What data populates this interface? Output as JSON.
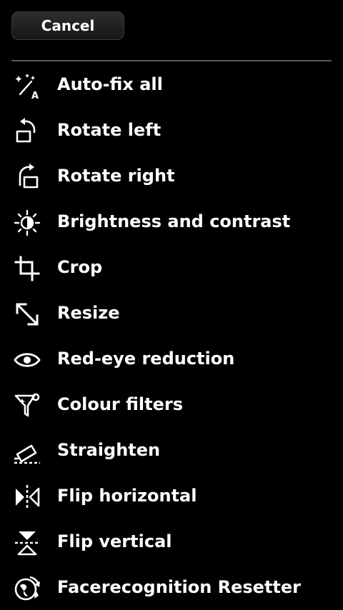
{
  "header": {
    "cancel_label": "Cancel"
  },
  "menu": {
    "items": [
      {
        "label": "Auto-fix all",
        "icon": "magic-wand-icon"
      },
      {
        "label": "Rotate left",
        "icon": "rotate-left-icon"
      },
      {
        "label": "Rotate right",
        "icon": "rotate-right-icon"
      },
      {
        "label": "Brightness and contrast",
        "icon": "brightness-icon"
      },
      {
        "label": "Crop",
        "icon": "crop-icon"
      },
      {
        "label": "Resize",
        "icon": "resize-icon"
      },
      {
        "label": "Red-eye reduction",
        "icon": "eye-icon"
      },
      {
        "label": "Colour filters",
        "icon": "colour-filter-icon"
      },
      {
        "label": "Straighten",
        "icon": "straighten-icon"
      },
      {
        "label": "Flip horizontal",
        "icon": "flip-horizontal-icon"
      },
      {
        "label": "Flip vertical",
        "icon": "flip-vertical-icon"
      },
      {
        "label": "Facerecognition Resetter",
        "icon": "face-recognition-icon"
      }
    ]
  },
  "colors": {
    "background": "#000000",
    "text": "#ffffff",
    "divider": "#5a5a5a"
  }
}
